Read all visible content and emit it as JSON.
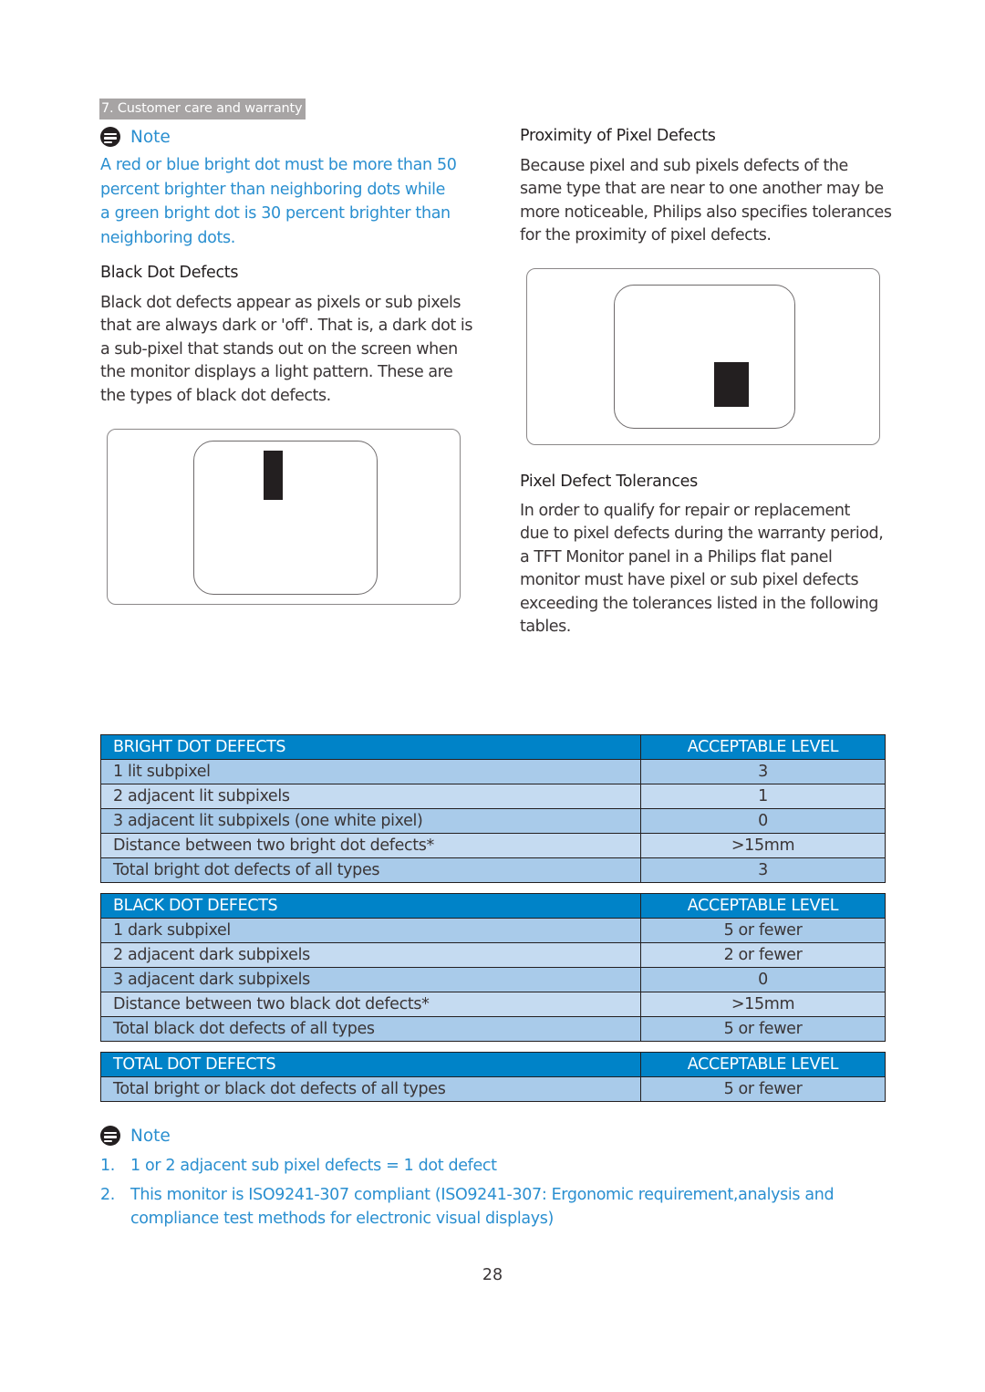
{
  "header": {
    "section_tag": "7. Customer care and warranty"
  },
  "left_column": {
    "note": {
      "label": "Note",
      "lines": [
        "A red or blue bright dot must be more than 50",
        "percent brighter than neighboring dots while",
        "a green bright dot is 30 percent brighter than",
        "neighboring dots."
      ]
    },
    "black_dot_defects": {
      "heading": "Black Dot Defects",
      "lines": [
        "Black dot defects appear as pixels or sub pixels",
        "that are always dark or 'off'. That is, a dark dot is",
        "a sub-pixel that stands out on the screen when",
        "the monitor displays a light pattern. These are",
        "the types of black dot defects."
      ],
      "figure_icon": "monitor-single-dark-subpixel-illustration"
    }
  },
  "right_column": {
    "proximity": {
      "heading": "Proximity of Pixel Defects",
      "lines": [
        "Because pixel and sub pixels defects of the",
        "same type that are near to one another may be",
        "more noticeable, Philips also specifies tolerances",
        "for the proximity of pixel defects."
      ],
      "figure_icon": "monitor-dark-pixel-proximity-illustration"
    },
    "tolerances": {
      "heading": "Pixel Defect Tolerances",
      "lines": [
        "In order to qualify for repair or replacement",
        "due to pixel defects during the warranty period,",
        "a TFT Monitor panel in a Philips flat panel",
        "monitor must have pixel or sub pixel defects",
        "exceeding the tolerances listed in the following",
        "tables."
      ]
    }
  },
  "tables": [
    {
      "header": [
        "BRIGHT DOT DEFECTS",
        "ACCEPTABLE LEVEL"
      ],
      "rows": [
        [
          "1 lit subpixel",
          "3"
        ],
        [
          "2 adjacent lit subpixels",
          "1"
        ],
        [
          "3 adjacent lit subpixels (one white pixel)",
          "0"
        ],
        [
          "Distance between two bright dot defects*",
          ">15mm"
        ],
        [
          "Total bright dot defects of all types",
          "3"
        ]
      ]
    },
    {
      "header": [
        "BLACK DOT DEFECTS",
        "ACCEPTABLE LEVEL"
      ],
      "rows": [
        [
          "1 dark subpixel",
          "5 or fewer"
        ],
        [
          "2 adjacent dark subpixels",
          "2 or fewer"
        ],
        [
          "3 adjacent dark subpixels",
          "0"
        ],
        [
          "Distance between two black dot defects*",
          ">15mm"
        ],
        [
          "Total black dot defects of all types",
          "5 or fewer"
        ]
      ]
    },
    {
      "header": [
        "TOTAL DOT DEFECTS",
        "ACCEPTABLE LEVEL"
      ],
      "rows": [
        [
          "Total bright or black dot defects of all types",
          "5 or fewer"
        ]
      ]
    }
  ],
  "bottom_note": {
    "label": "Note",
    "items": [
      {
        "num": "1.",
        "lines": [
          "1 or 2 adjacent sub pixel defects = 1 dot defect"
        ]
      },
      {
        "num": "2.",
        "lines": [
          "This monitor is ISO9241-307 compliant (ISO9241-307: Ergonomic requirement,analysis and",
          "compliance test methods for electronic visual displays)"
        ]
      }
    ]
  },
  "page_number": "28",
  "colors": {
    "accent_blue": "#2a8fd0",
    "table_header": "#0083c8",
    "row_dark": "#a9cbea",
    "row_light": "#c5dbf1",
    "section_tag_bg": "#a7a4a4"
  }
}
